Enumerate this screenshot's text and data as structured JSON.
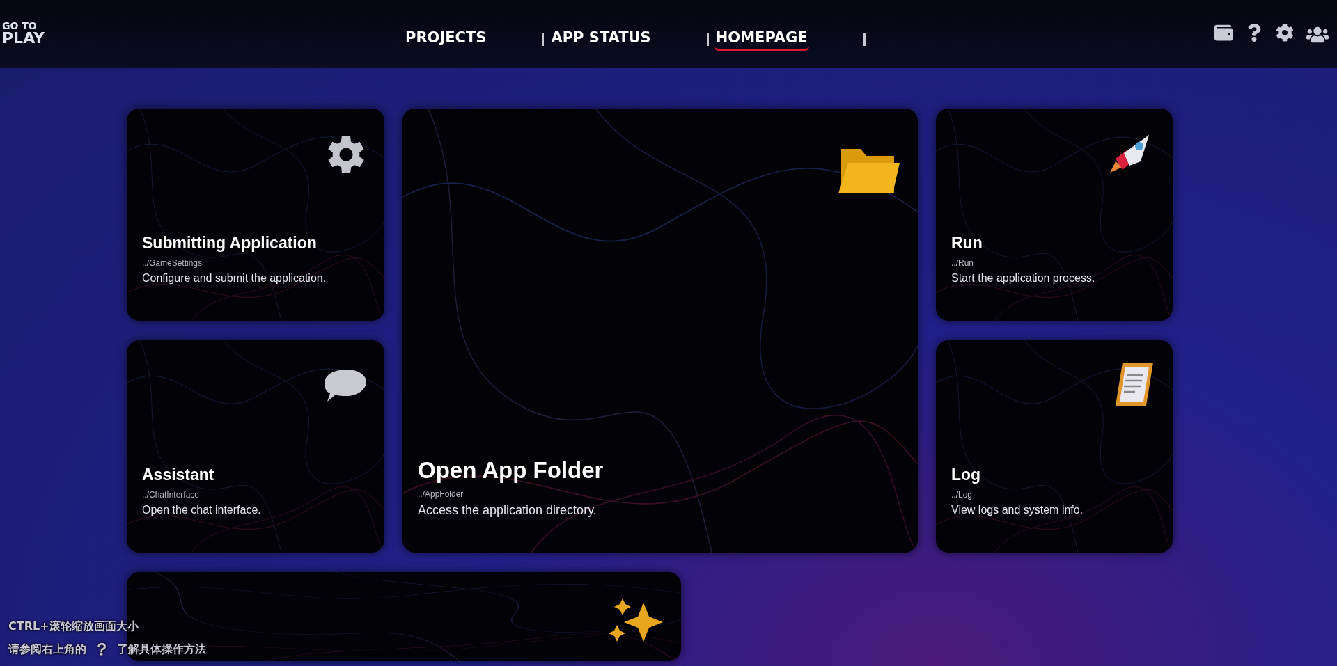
{
  "logo": {
    "line_1": "GO TO",
    "line_2": "PLAY"
  },
  "nav": [
    {
      "label": "PROJECTS",
      "selected": false
    },
    {
      "label": "APP STATUS",
      "selected": false
    },
    {
      "label": "HOMEPAGE",
      "selected": true
    }
  ],
  "cards": [
    {
      "kind": "gear",
      "title": "Submitting Application",
      "path": "../GameSettings",
      "description": "Configure and submit the application."
    },
    {
      "kind": "folder",
      "title": "Open App Folder",
      "path": "../AppFolder",
      "description": "Access the application directory."
    },
    {
      "kind": "rocket",
      "title": "Run",
      "path": "../Run",
      "description": "Start the application process."
    },
    {
      "kind": "chat",
      "title": "Assistant",
      "path": "../ChatInterface",
      "description": "Open the chat interface."
    },
    {
      "kind": "clipboard",
      "title": "Log",
      "path": "../Log",
      "description": "View logs and system info."
    },
    {
      "kind": "sparkle"
    }
  ],
  "hint": {
    "line_1": "CTRL+滚轮缩放画面大小",
    "line_2_before": "请参阅右上角的",
    "line_2_mark": "？",
    "line_2_after": "了解具体操作方法"
  }
}
